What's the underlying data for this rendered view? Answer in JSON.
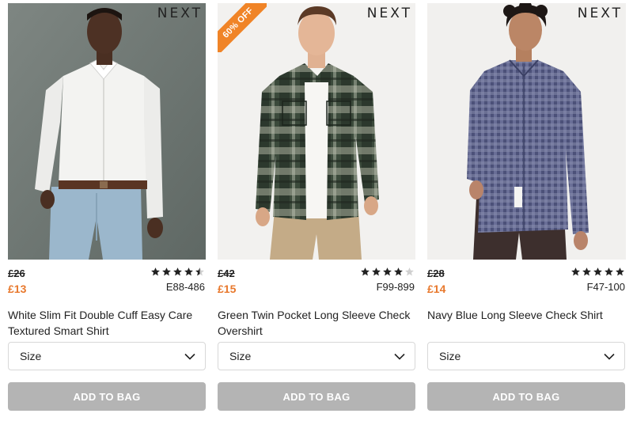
{
  "products": [
    {
      "brand": "NEXT",
      "promo": "",
      "price_old": "£26",
      "price_new": "£13",
      "rating": 4.5,
      "sku": "E88-486",
      "title": "White Slim Fit Double Cuff Easy Care Textured Smart Shirt",
      "size_label": "Size",
      "add_label": "ADD TO BAG"
    },
    {
      "brand": "NEXT",
      "promo": "60% OFF",
      "price_old": "£42",
      "price_new": "£15",
      "rating": 4,
      "sku": "F99-899",
      "title": "Green Twin Pocket Long Sleeve Check Overshirt",
      "size_label": "Size",
      "add_label": "ADD TO BAG"
    },
    {
      "brand": "NEXT",
      "promo": "",
      "price_old": "£28",
      "price_new": "£14",
      "rating": 5,
      "sku": "F47-100",
      "title": "Navy Blue Long Sleeve Check Shirt",
      "size_label": "Size",
      "add_label": "ADD TO BAG"
    }
  ],
  "colors": {
    "sale_price": "#e8782c",
    "promo_badge": "#f08427",
    "button_disabled": "#b4b4b4",
    "star": "#222222"
  },
  "icons": {
    "rating": "star-icon",
    "dropdown": "chevron-down-icon"
  }
}
